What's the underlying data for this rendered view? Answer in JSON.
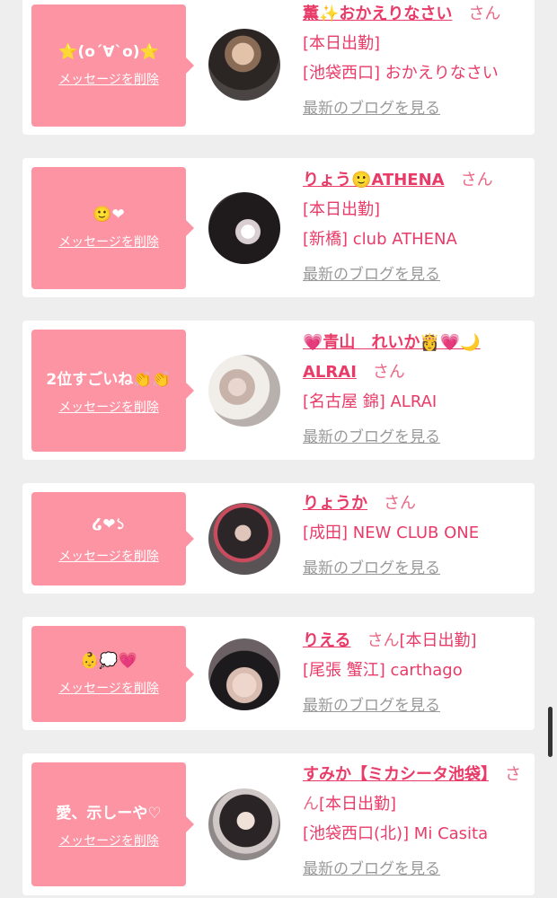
{
  "delete_label": "メッセージを削除",
  "blog_label": "最新のブログを見る",
  "san_label": "さん",
  "cards": [
    {
      "message": "⭐(o´∀`o)⭐",
      "name": "薫✨おかえりなさい",
      "status": "[本日出勤]",
      "shop": "[池袋西口] おかえりなさい"
    },
    {
      "message": "🙂❤",
      "name": "りょう🙂ATHENA",
      "status": "[本日出勤]",
      "shop": "[新橋] club ATHENA"
    },
    {
      "message": "2位すごいね👏👏",
      "name": "💗青山　れいか👸💗🌙ALRAI",
      "status": "",
      "shop": "[名古屋 錦] ALRAI"
    },
    {
      "message": "໒❤১",
      "name": "りょうか",
      "status": "",
      "shop": "[成田] NEW CLUB ONE"
    },
    {
      "message": "👶💭💗",
      "name": "りえる",
      "status": "[本日出勤]",
      "shop": "[尾張 蟹江] carthago"
    },
    {
      "message": "愛、示しーや♡",
      "name": "すみか【ミカシータ池袋】",
      "status": "[本日出勤]",
      "shop": "[池袋西口(北)] Mi Casita"
    }
  ]
}
